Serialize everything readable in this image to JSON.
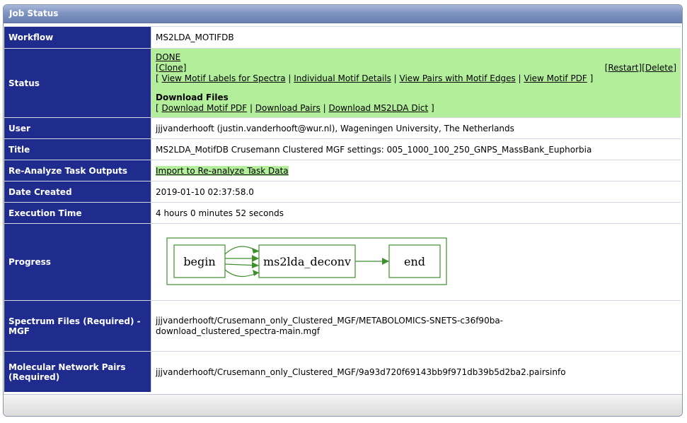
{
  "header": {
    "title": "Job Status"
  },
  "rows": {
    "workflow": {
      "label": "Workflow",
      "value": "MS2LDA_MOTIFDB"
    },
    "status": {
      "label": "Status",
      "state": "DONE",
      "clone": "[Clone]",
      "restart": "[Restart]",
      "delete": "[Delete]",
      "views_open": "[",
      "views": [
        "View Motif Labels for Spectra",
        "Individual Motif Details",
        "View Pairs with Motif Edges",
        "View Motif PDF"
      ],
      "views_close": "]",
      "download_title": "Download Files",
      "downloads": [
        "Download Motif PDF",
        "Download Pairs",
        "Download MS2LDA Dict"
      ]
    },
    "user": {
      "label": "User",
      "value": "jjjvanderhooft (justin.vanderhooft@wur.nl), Wageningen University, The Netherlands"
    },
    "title": {
      "label": "Title",
      "value": "MS2LDA_MotifDB Crusemann Clustered MGF settings: 005_1000_100_250_GNPS_MassBank_Euphorbia"
    },
    "reanalyze": {
      "label": "Re-Analyze Task Outputs",
      "link": "Import to Re-analyze Task Data"
    },
    "date_created": {
      "label": "Date Created",
      "value": "2019-01-10 02:37:58.0"
    },
    "execution_time": {
      "label": "Execution Time",
      "value": "4 hours 0 minutes 52 seconds"
    },
    "progress": {
      "label": "Progress",
      "nodes": [
        "begin",
        "ms2lda_deconv",
        "end"
      ],
      "color": "#3f8f2e"
    },
    "spectrum_files": {
      "label": "Spectrum Files (Required) - MGF",
      "value_line1": "jjjvanderhooft/Crusemann_only_Clustered_MGF/METABOLOMICS-SNETS-c36f90ba-",
      "value_line2": "download_clustered_spectra-main.mgf"
    },
    "network_pairs": {
      "label": "Molecular Network Pairs (Required)",
      "value": "jjjvanderhooft/Crusemann_only_Clustered_MGF/9a93d720f69143bb9f971db39b5d2ba2.pairsinfo"
    }
  },
  "colors": {
    "label_bg": "#1f2c8e",
    "status_bg": "#b3ef9b",
    "header_bg": "#7f94c2"
  }
}
